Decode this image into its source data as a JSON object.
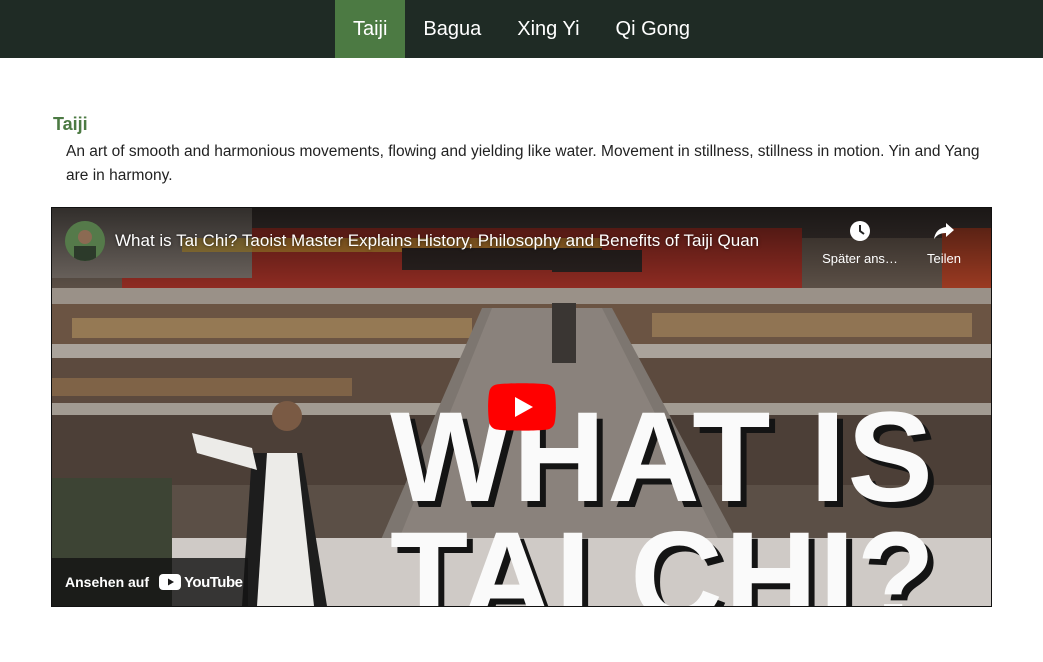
{
  "nav": {
    "items": [
      {
        "label": "Taiji",
        "active": true
      },
      {
        "label": "Bagua",
        "active": false
      },
      {
        "label": "Xing Yi",
        "active": false
      },
      {
        "label": "Qi Gong",
        "active": false
      }
    ]
  },
  "section": {
    "title": "Taiji",
    "description": "An art of smooth and harmonious movements, flowing and yielding like water. Movement in stillness, stillness in motion. Yin and Yang are in harmony."
  },
  "video": {
    "title": "What is Tai Chi? Taoist Master Explains History, Philosophy and Benefits of Taiji Quan",
    "watch_later_label": "Später ans…",
    "share_label": "Teilen",
    "thumbnail_line1": "WHAT IS",
    "thumbnail_line2": "TAI CHI?",
    "watch_on_label": "Ansehen auf",
    "youtube_wordmark": "YouTube"
  },
  "colors": {
    "nav_bg": "#1f2b25",
    "accent": "#4c7a43",
    "youtube_red": "#ff0000"
  },
  "icons": [
    "clock-icon",
    "share-icon",
    "play-icon",
    "youtube-logo-icon"
  ]
}
